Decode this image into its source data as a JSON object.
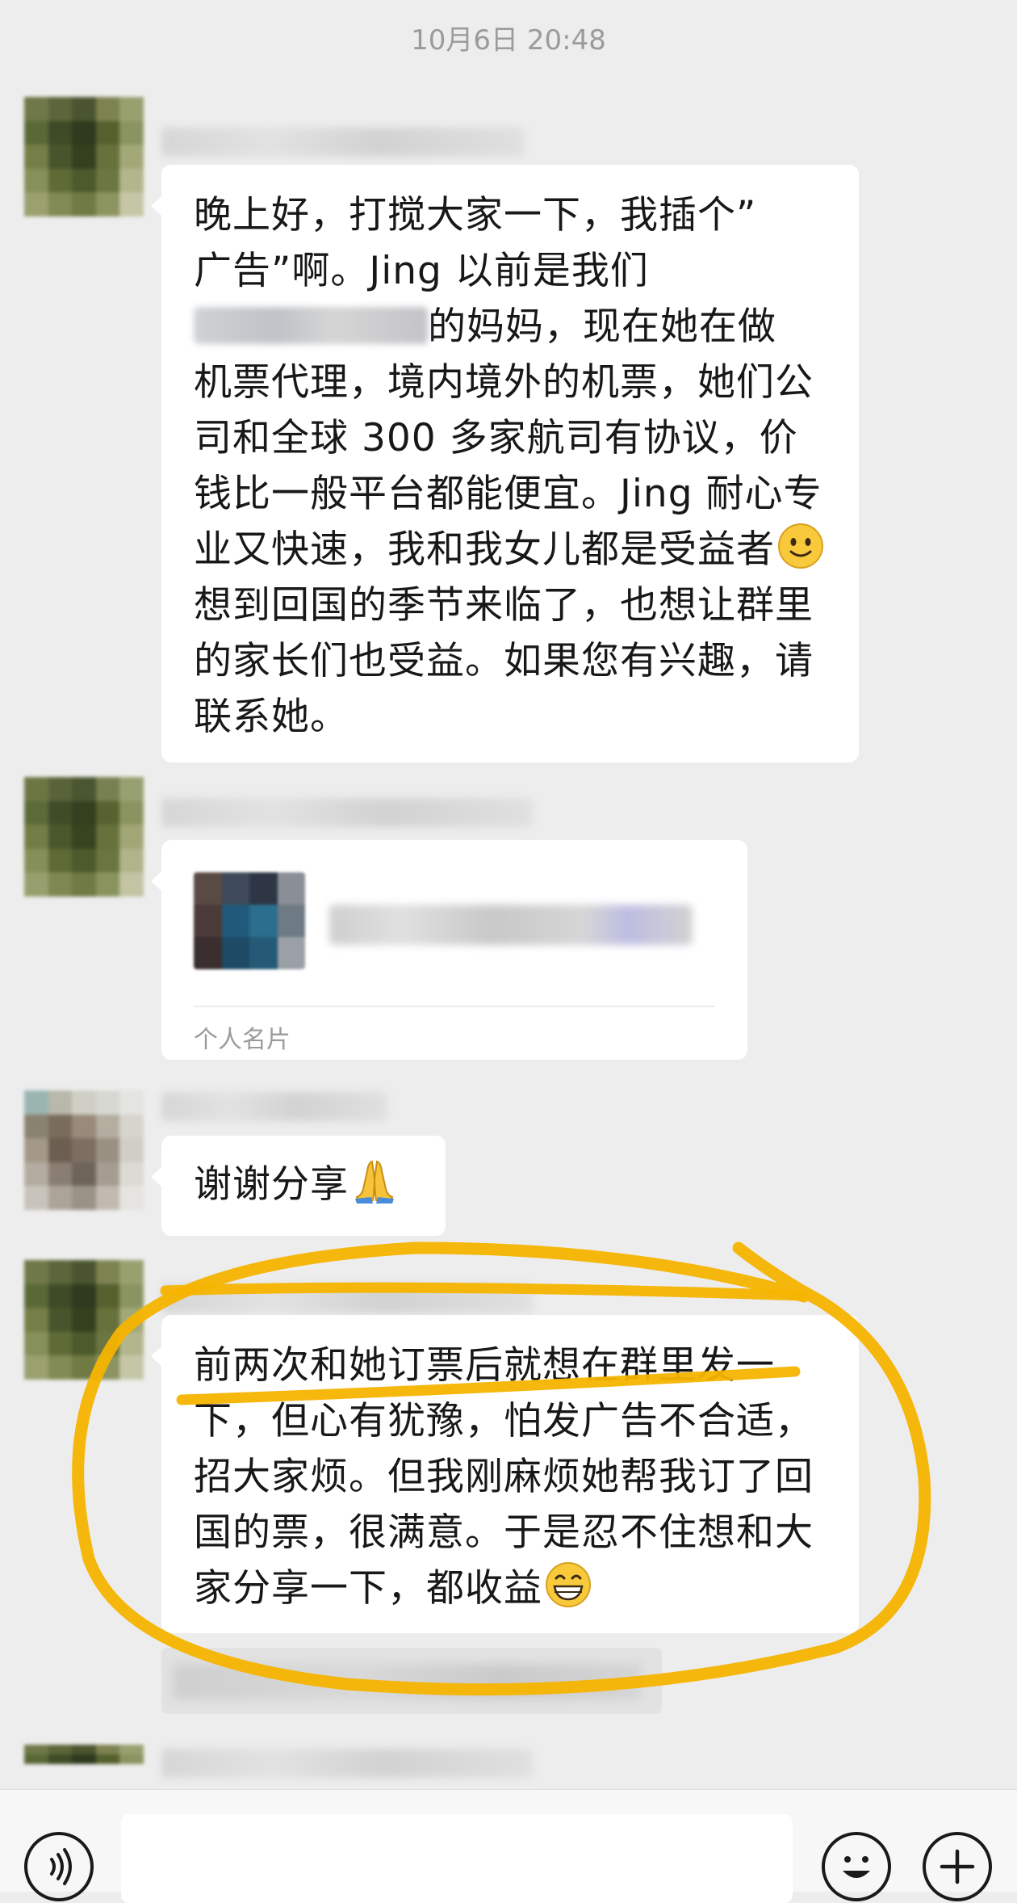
{
  "timestamp": "10月6日 20:48",
  "messages": [
    {
      "type": "text",
      "text_line1": "晚上好，打搅大家一下，我插个”",
      "text_line2": "广告”啊。Jing 以前是我们",
      "text_after_blur": "的妈妈，现在她在做",
      "text_rest": "机票代理，境内境外的机票，她们公司和全球 300 多家航司有协议，价钱比一般平台都能便宜。Jing 耐心专业又快速，我和我女儿都是受益者",
      "emoji": "slightly-smiling-face-icon",
      "text_tail": "想到回国的季节来临了，也想让群里的家长们也受益。如果您有兴趣，请联系她。"
    },
    {
      "type": "contact_card",
      "label": "个人名片"
    },
    {
      "type": "text",
      "text": "谢谢分享",
      "emoji": "folded-hands-icon"
    },
    {
      "type": "text",
      "text": "前两次和她订票后就想在群里发一下，但心有犹豫，怕发广告不合适，招大家烦。但我刚麻烦她帮我订了回国的票，很满意。于是忍不住想和大家分享一下，都收益",
      "emoji": "grinning-face-icon"
    }
  ],
  "colors": {
    "background": "#ededed",
    "bubble": "#ffffff",
    "annotation": "#f5b400",
    "timestamp": "#9b9b9b"
  }
}
